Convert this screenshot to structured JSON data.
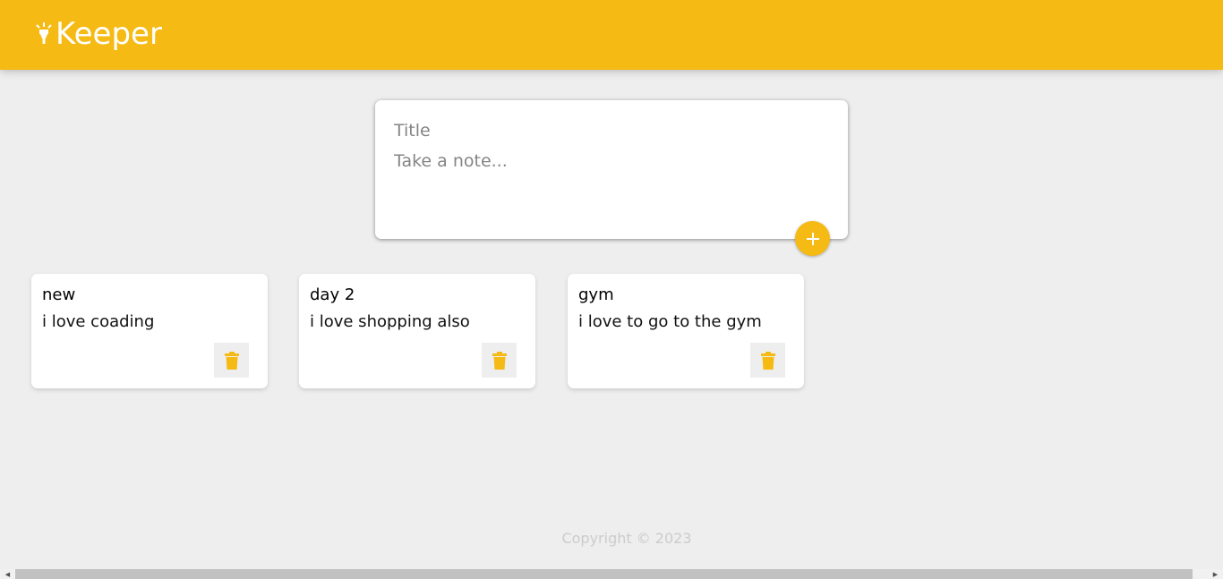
{
  "header": {
    "brand": "Keeper",
    "brand_icon": "highlight-lamp-icon",
    "background": "#f5ba13"
  },
  "create_note": {
    "title_placeholder": "Title",
    "content_placeholder": "Take a note...",
    "add_icon": "plus-icon"
  },
  "notes": [
    {
      "title": "new",
      "content": "i love coading",
      "delete_icon": "trash-icon"
    },
    {
      "title": "day 2",
      "content": "i love shopping also",
      "delete_icon": "trash-icon"
    },
    {
      "title": "gym",
      "content": "i love to go to the gym",
      "delete_icon": "trash-icon"
    }
  ],
  "footer": {
    "copyright": "Copyright © 2023"
  },
  "colors": {
    "accent": "#f5ba13",
    "page_bg": "#eeeeee"
  }
}
